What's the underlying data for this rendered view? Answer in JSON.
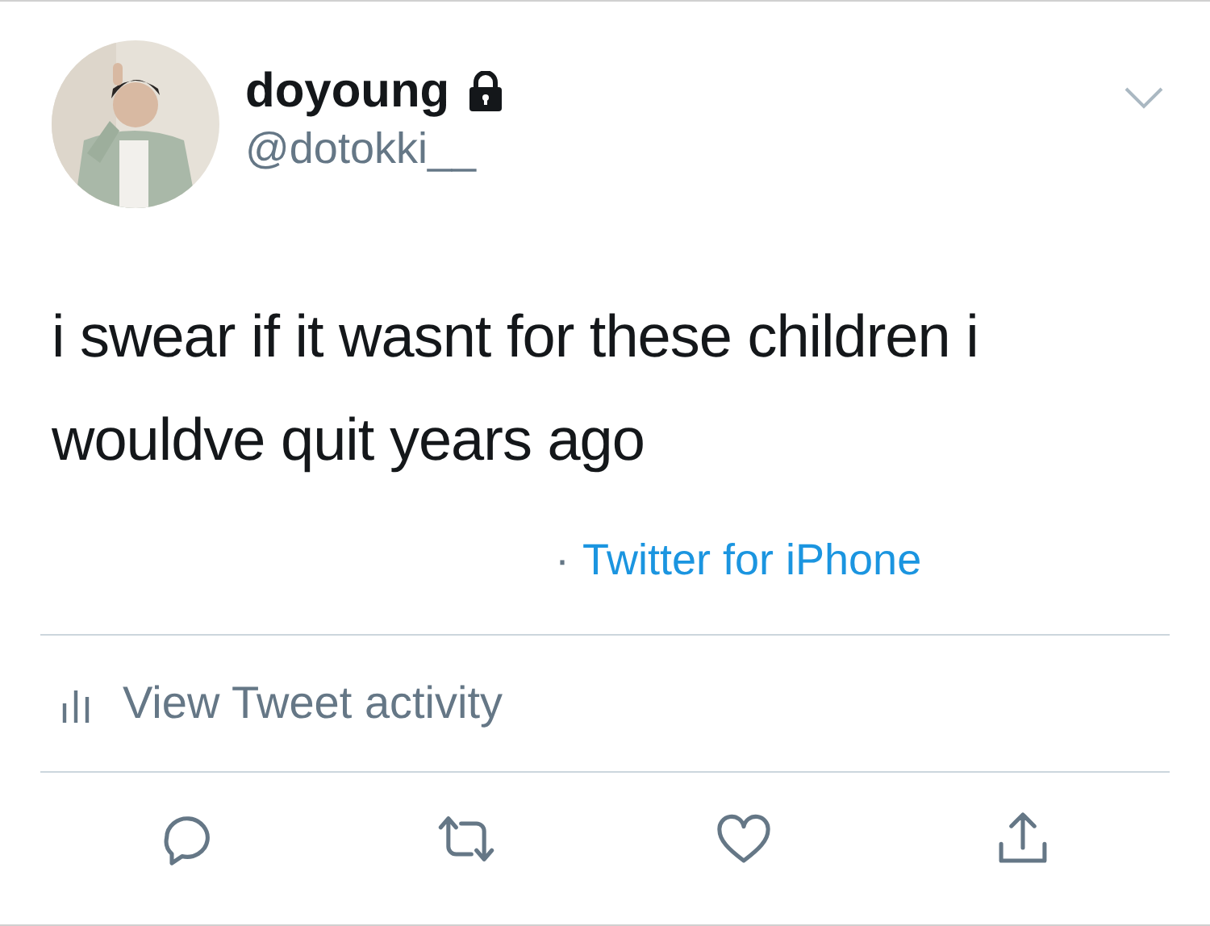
{
  "author": {
    "name": "doyoung",
    "protected": true,
    "handle": "@dotokki__"
  },
  "tweet": {
    "text": "i swear if it wasnt for these children i wouldve quit years ago"
  },
  "meta": {
    "separator": "·",
    "source": "Twitter for iPhone"
  },
  "activity": {
    "label": "View Tweet activity"
  },
  "actions": [
    {
      "kind": "reply"
    },
    {
      "kind": "retweet"
    },
    {
      "kind": "like"
    },
    {
      "kind": "share"
    }
  ]
}
